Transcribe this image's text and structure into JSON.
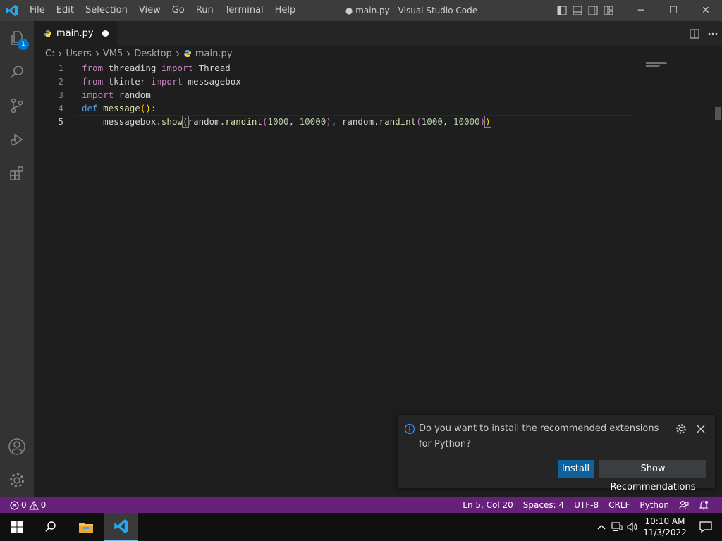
{
  "colors": {
    "titlebar": "#3c3c3c",
    "activitybar": "#333333",
    "editor": "#1e1e1e",
    "statusbar": "#68217a",
    "accent": "#007acc",
    "install_button": "#0e639c"
  },
  "titlebar": {
    "app_icon": "vscode-logo-icon",
    "menu": [
      "File",
      "Edit",
      "Selection",
      "View",
      "Go",
      "Run",
      "Terminal",
      "Help"
    ],
    "window_title": "● main.py - Visual Studio Code",
    "layout_icons": [
      "toggle-primary-sidebar-icon",
      "toggle-panel-icon",
      "toggle-secondary-sidebar-icon",
      "customize-layout-icon"
    ],
    "window_controls": {
      "minimize": "─",
      "maximize": "☐",
      "close": "✕"
    }
  },
  "activitybar": {
    "items": [
      "explorer-icon",
      "search-icon",
      "source-control-icon",
      "run-debug-icon",
      "extensions-icon"
    ],
    "explorer_badge": "1",
    "bottom": [
      "accounts-icon",
      "manage-gear-icon"
    ]
  },
  "tabs": [
    {
      "label": "main.py",
      "icon": "python-file-icon",
      "dirty": true
    }
  ],
  "tab_actions": [
    "split-editor-icon",
    "more-actions-icon"
  ],
  "breadcrumb": [
    "C:",
    "Users",
    "VM5",
    "Desktop",
    "main.py"
  ],
  "editor": {
    "line_numbers": [
      "1",
      "2",
      "3",
      "4",
      "5"
    ],
    "active_line": 5,
    "code": {
      "l1": {
        "kw1": "from",
        "mod": " threading ",
        "kw2": "import",
        "name": " Thread"
      },
      "l2": {
        "kw1": "from",
        "mod": " tkinter ",
        "kw2": "import",
        "name": " messagebox"
      },
      "l3": {
        "kw1": "import",
        "name": " random"
      },
      "l4": {
        "kw": "def",
        "sp": " ",
        "fn": "message",
        "p": "():"
      },
      "l5": {
        "indent": "    ",
        "obj": "messagebox.",
        "fn": "show",
        "open": "(",
        "a1": "random.",
        "f1": "randint",
        "o1": "(",
        "n1": "1000",
        "c1": ", ",
        "n2": "10000",
        "cl1": ")",
        "sep": ", ",
        "a2": "random.",
        "f2": "randint",
        "o2": "(",
        "n3": "1000",
        "c2": ", ",
        "n4": "10000",
        "cl2": ")",
        "close": ")"
      }
    }
  },
  "notification": {
    "icon": "info-icon",
    "message": "Do you want to install the recommended extensions for Python?",
    "gear_icon": "gear-icon",
    "close_icon": "close-icon",
    "install_label": "Install",
    "show_label": "Show Recommendations"
  },
  "statusbar": {
    "errors": "0",
    "warnings": "0",
    "position": "Ln 5, Col 20",
    "spaces": "Spaces: 4",
    "encoding": "UTF-8",
    "eol": "CRLF",
    "language": "Python",
    "feedback_icon": "feedback-person-icon",
    "notifications_icon": "bell-icon"
  },
  "taskbar": {
    "items": [
      "windows-start-icon",
      "search-icon",
      "file-explorer-icon",
      "vscode-taskbar-icon"
    ],
    "tray_icons": [
      "chevron-up-icon",
      "network-icon",
      "volume-icon"
    ],
    "time": "10:10 AM",
    "date": "11/3/2022",
    "notification_icon": "action-center-icon"
  }
}
